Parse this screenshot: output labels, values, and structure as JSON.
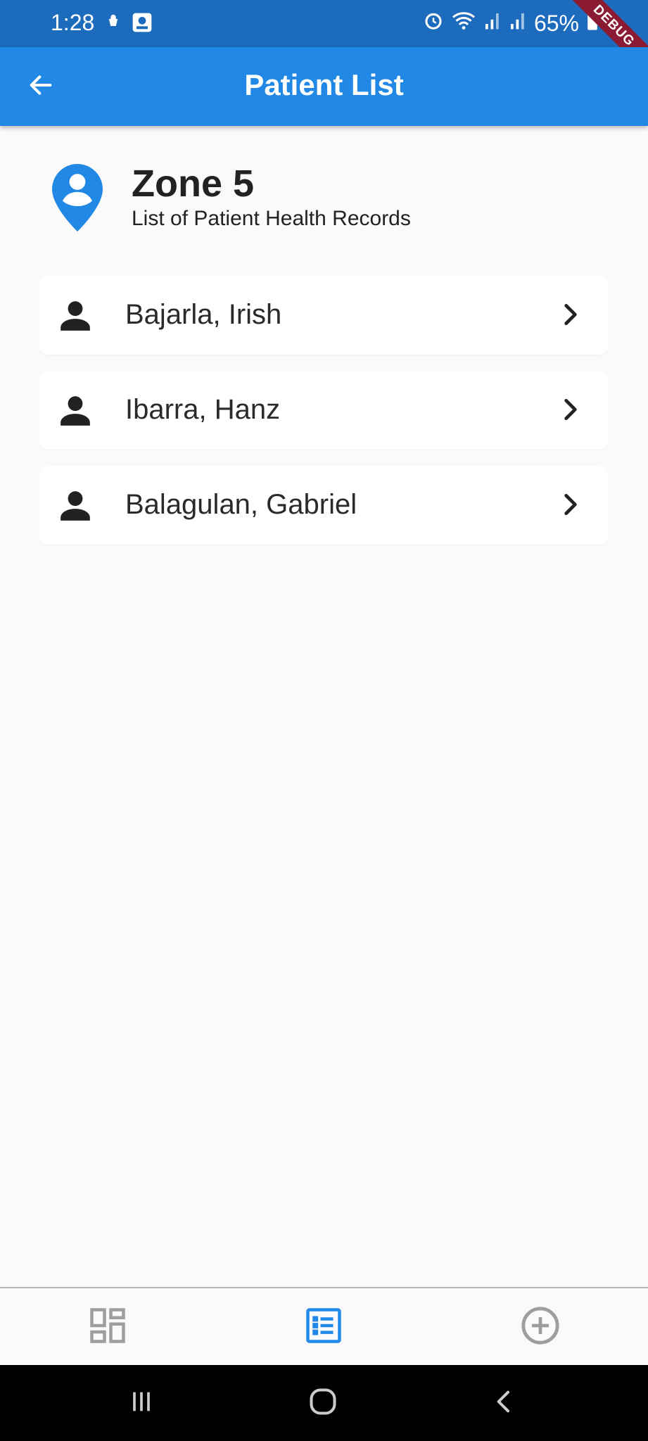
{
  "status_bar": {
    "time": "1:28",
    "battery": "65%",
    "debug_label": "DEBUG",
    "background": "#1c6bbd"
  },
  "app_bar": {
    "title": "Patient List",
    "back_icon": "arrow-back-icon",
    "background": "#2188e5"
  },
  "zone": {
    "title": "Zone 5",
    "subtitle": "List of Patient Health Records",
    "icon": "location-pin-icon",
    "icon_color": "#2188e5"
  },
  "patients": [
    {
      "name": "Bajarla, Irish"
    },
    {
      "name": "Ibarra, Hanz"
    },
    {
      "name": "Balagulan, Gabriel"
    }
  ],
  "bottom_nav": {
    "items": [
      {
        "icon": "dashboard-icon",
        "active": false
      },
      {
        "icon": "list-icon",
        "active": true
      },
      {
        "icon": "add-circle-icon",
        "active": false
      }
    ],
    "active_color": "#2188e5",
    "inactive_color": "#9e9e9e"
  },
  "system_nav": {
    "items": [
      "recent-apps-icon",
      "home-icon",
      "back-icon"
    ]
  }
}
